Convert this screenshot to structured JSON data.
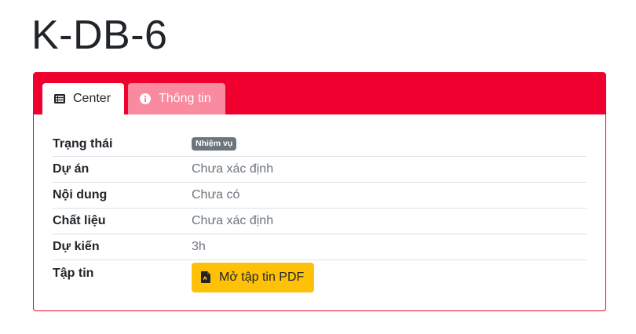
{
  "page": {
    "title": "K-DB-6"
  },
  "tabs": [
    {
      "label": "Center",
      "icon": "list-icon",
      "active": true
    },
    {
      "label": "Thông tin",
      "icon": "info-circle-icon",
      "active": false
    }
  ],
  "details": {
    "status": {
      "label": "Trạng thái",
      "badge": "Nhiệm vụ"
    },
    "project": {
      "label": "Dự án",
      "value": "Chưa xác định"
    },
    "content": {
      "label": "Nội dung",
      "value": "Chưa có"
    },
    "material": {
      "label": "Chất liệu",
      "value": "Chưa xác định"
    },
    "estimate": {
      "label": "Dự kiến",
      "value": "3h"
    },
    "file": {
      "label": "Tập tin",
      "button": "Mở tập tin PDF",
      "icon": "file-pdf-icon"
    }
  },
  "colors": {
    "card_accent": "#f0002f",
    "inactive_tab": "#f98aa0",
    "badge": "#6c757d",
    "pdf_button": "#ffc107"
  }
}
